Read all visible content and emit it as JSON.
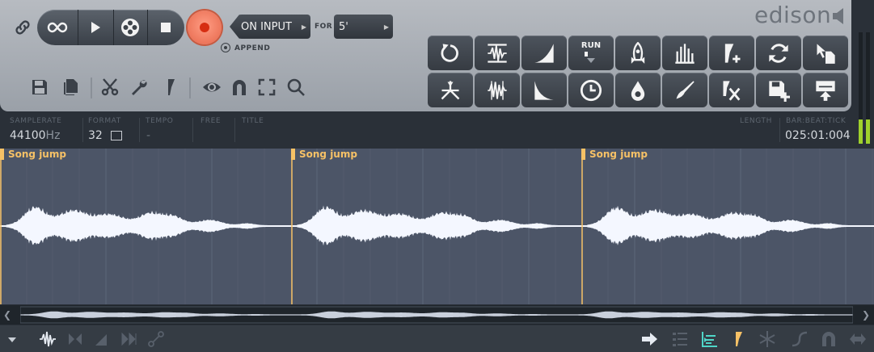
{
  "app": {
    "brand": "edison"
  },
  "transport": {
    "loop_icon": "infinity-icon",
    "play_icon": "play-icon",
    "film_icon": "reel-icon",
    "stop_icon": "stop-icon"
  },
  "record": {
    "mode_label": "ON INPUT",
    "for_label": "FOR",
    "for_value": "5'",
    "append_label": "APPEND"
  },
  "info": {
    "samplerate_label": "SAMPLERATE",
    "samplerate_value": "44100",
    "samplerate_unit": "Hz",
    "format_label": "FORMAT",
    "format_value": "32",
    "tempo_label": "TEMPO",
    "tempo_value": "-",
    "free_label": "FREE",
    "title_label": "TITLE",
    "length_label": "LENGTH",
    "bbt_label": "BAR:BEAT:TICK",
    "bbt_value": "025:01:004"
  },
  "grid_buttons": {
    "run_label": "RUN"
  },
  "markers": [
    {
      "label": "Song jump"
    },
    {
      "label": "Song jump"
    },
    {
      "label": "Song jump"
    }
  ],
  "colors": {
    "accent_record": "#e5664a",
    "marker": "#f6c166",
    "waveform": "#f4f7ff",
    "meter": "#9fd12c",
    "highlight_icon": "#4fd6c8"
  }
}
